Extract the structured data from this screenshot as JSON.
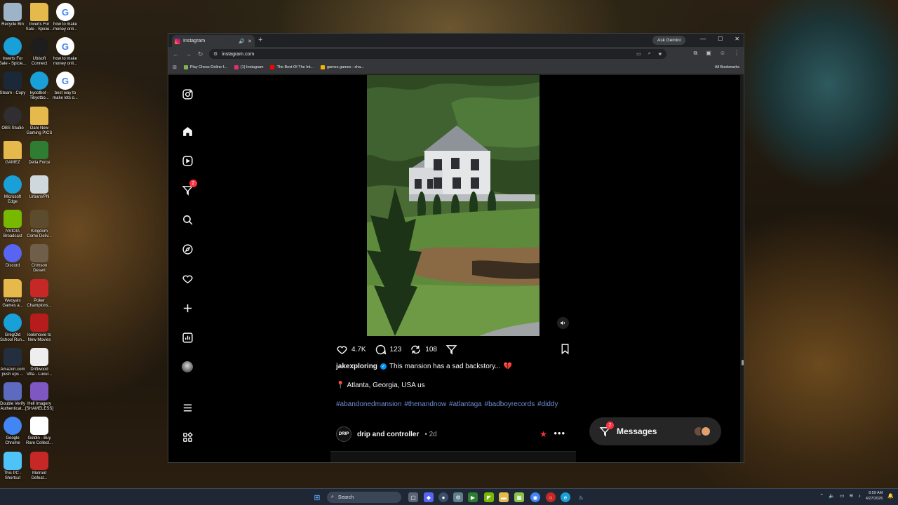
{
  "desktop": {
    "icons": [
      {
        "label": "Recycle Bin",
        "icon": "recycle-bin-icon",
        "color": "#9db4c8"
      },
      {
        "label": "Inverts For\nSale - Spicie...",
        "icon": "folder-icon",
        "color": "#e6b94c"
      },
      {
        "label": "how to make\nmoney onli...",
        "icon": "google-icon",
        "color": "#ffffff"
      },
      {
        "label": "Inverts For\nSale - Spicie...",
        "icon": "edge-icon",
        "color": "#1aa0d8"
      },
      {
        "label": "Ubisoft\nConnect",
        "icon": "ubisoft-icon",
        "color": "#1d1d1d"
      },
      {
        "label": "how to make\nmoney onli...",
        "icon": "google-icon",
        "color": "#ffffff"
      },
      {
        "label": "Steam - Copy",
        "icon": "steam-icon",
        "color": "#1b2838"
      },
      {
        "label": "kyootbot -\nTikyotbo...",
        "icon": "edge-icon",
        "color": "#1aa0d8"
      },
      {
        "label": "best way to\nmake lots o...",
        "icon": "google-icon",
        "color": "#ffffff"
      },
      {
        "label": "OBS Studio",
        "icon": "obs-icon",
        "color": "#302e31"
      },
      {
        "label": "Dani New\nGaming PICS",
        "icon": "folder-icon",
        "color": "#e6b94c"
      },
      {
        "label": "GAMEZ",
        "icon": "folder-icon",
        "color": "#e6b94c"
      },
      {
        "label": "Delta Force",
        "icon": "delta-force-icon",
        "color": "#2e7d32"
      },
      {
        "label": "Microsoft\nEdge",
        "icon": "edge-icon",
        "color": "#1aa0d8"
      },
      {
        "label": "UrbanVPN",
        "icon": "urbanvpn-icon",
        "color": "#cfd8dc"
      },
      {
        "label": "NVIDIA\nBroadcast",
        "icon": "nvidia-icon",
        "color": "#76b900"
      },
      {
        "label": "Kingdom\nCome Deliv...",
        "icon": "kingdom-icon",
        "color": "#5d4b2e"
      },
      {
        "label": "Discord",
        "icon": "discord-icon",
        "color": "#5865f2"
      },
      {
        "label": "Crimson\nDesert",
        "icon": "crimson-icon",
        "color": "#6e5e4a"
      },
      {
        "label": "Weoyals\nGames a...",
        "icon": "folder-icon",
        "color": "#e6b94c"
      },
      {
        "label": "Poker\nChampions...",
        "icon": "poker-icon",
        "color": "#c62828"
      },
      {
        "label": "GregOld\nSchool Run...",
        "icon": "edge-icon",
        "color": "#1aa0d8"
      },
      {
        "label": "lookmovie to\nNew Movies",
        "icon": "lookmovie-icon",
        "color": "#b71c1c"
      },
      {
        "label": "Amazon.com\npush ups ...",
        "icon": "amazon-icon",
        "color": "#232f3e"
      },
      {
        "label": "Driftwood\nVilla - Luxur...",
        "icon": "document-icon",
        "color": "#eeeeee"
      },
      {
        "label": "Double Verify\nAuthenticat...",
        "icon": "verify-icon",
        "color": "#5c6bc0"
      },
      {
        "label": "Hell Imagery\n[SHAMELESS]",
        "icon": "image-icon",
        "color": "#7e57c2"
      },
      {
        "label": "Google\nChrome",
        "icon": "chrome-icon",
        "color": "#4285f4"
      },
      {
        "label": "Goldin - Buy\nRare Collect...",
        "icon": "goldin-icon",
        "color": "#ffffff"
      },
      {
        "label": "This PC -\nShortcut",
        "icon": "this-pc-icon",
        "color": "#4fc3f7"
      },
      {
        "label": "Metroid\nDefeat...",
        "icon": "game-icon",
        "color": "#c62828"
      }
    ]
  },
  "browser": {
    "tab_title": "Instagram",
    "new_tab": "+",
    "gemini_label": "Ask Gemini",
    "url": "instagram.com",
    "bookmarks": [
      {
        "label": "Play Chess Online f...",
        "color": "#81b64c"
      },
      {
        "label": "(1) Instagram",
        "color": "#e1306c"
      },
      {
        "label": "The Best Of The Int...",
        "color": "#ff0000"
      },
      {
        "label": "games games - sha...",
        "color": "#f4b400"
      }
    ],
    "all_bookmarks": "All Bookmarks"
  },
  "instagram": {
    "notifications_badge": "2",
    "post": {
      "likes": "4.7K",
      "comments": "123",
      "reposts": "108",
      "username": "jakexploring",
      "caption": "This mansion has a sad backstory...",
      "heart_emoji": "💔",
      "location": "Atlanta, Georgia, USA us",
      "hashtags": "#abandonedmansion #thenandnow #atlantaga #badboyrecords #diddy"
    },
    "next_post": {
      "avatar_text": "DRIP",
      "username": "drip and controller",
      "time": "• 2d"
    },
    "messages": {
      "label": "Messages",
      "badge": "2"
    }
  },
  "taskbar": {
    "search_placeholder": "Search",
    "time": "8:59 AM",
    "date": "4/27/2026"
  }
}
